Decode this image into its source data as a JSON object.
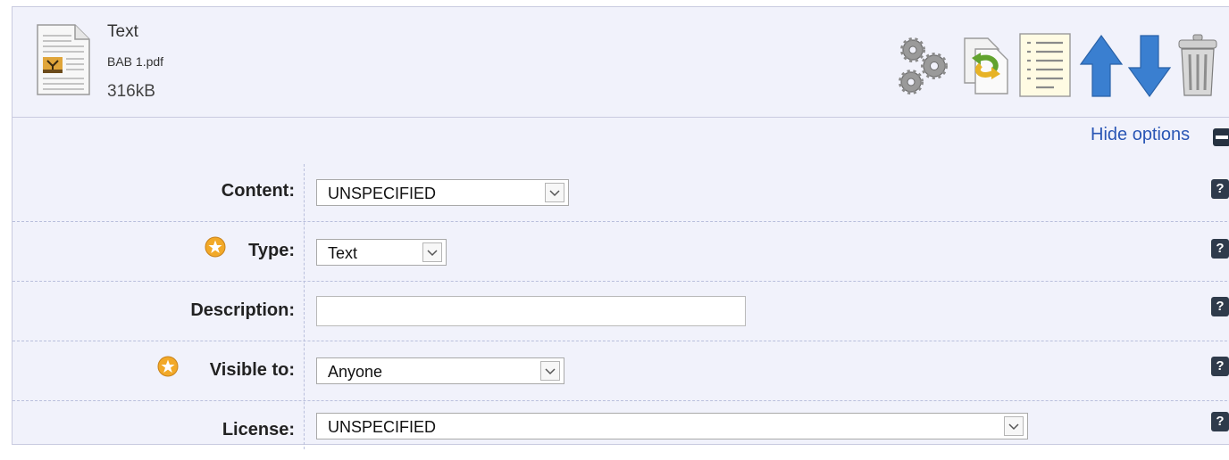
{
  "file": {
    "title": "Text",
    "name": "BAB 1.pdf",
    "size": "316kB"
  },
  "toolbar": {
    "icons": [
      "gears-icon",
      "convert-icon",
      "preview-icon",
      "move-up-icon",
      "move-down-icon",
      "trash-icon"
    ]
  },
  "options": {
    "hide_label": "Hide options"
  },
  "form": {
    "content": {
      "label": "Content:",
      "value": "UNSPECIFIED"
    },
    "type": {
      "label": "Type:",
      "value": "Text"
    },
    "description": {
      "label": "Description:",
      "value": ""
    },
    "visible": {
      "label": "Visible to:",
      "value": "Anyone"
    },
    "license": {
      "label": "License:",
      "value": "UNSPECIFIED"
    },
    "help_label": "?"
  },
  "colors": {
    "panel_bg": "#f1f2fb",
    "border": "#c9cbe0",
    "link": "#2a56b5",
    "arrow_blue": "#3a7fd0",
    "star": "#f2a928",
    "help_bg": "#2f3b4b"
  }
}
